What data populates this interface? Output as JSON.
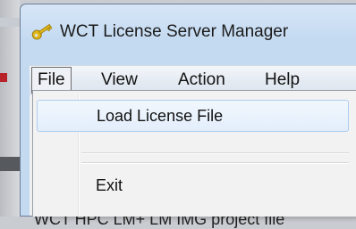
{
  "window": {
    "title": "WCT License Server Manager",
    "app_icon": "key-icon"
  },
  "menubar": {
    "items": [
      {
        "label": "File",
        "state": "open"
      },
      {
        "label": "View"
      },
      {
        "label": "Action"
      },
      {
        "label": "Help"
      }
    ]
  },
  "file_menu": {
    "items": [
      {
        "label": "Load License File",
        "highlighted": true
      },
      {
        "label": "",
        "separator": true
      },
      {
        "label": "Exit"
      }
    ]
  },
  "background": {
    "partial_text": "WCT HPC LM+ LM IMG project file"
  },
  "colors": {
    "menu_highlight_border": "#aecdf0",
    "menu_highlight_fill": "#e3eefb",
    "titlebar": "#c4daf1"
  }
}
